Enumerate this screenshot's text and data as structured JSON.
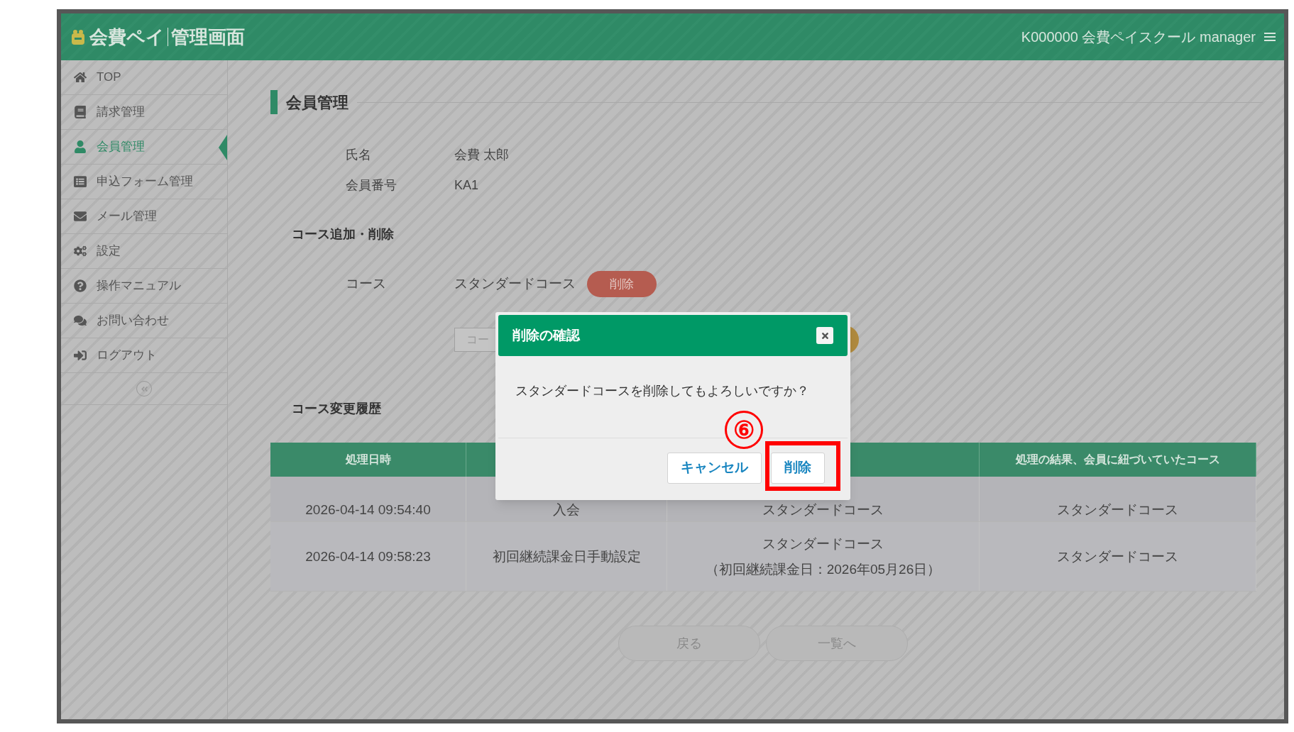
{
  "header": {
    "logo": "会費ペイ",
    "subtitle": "管理画面",
    "account": "K000000 会費ペイスクール manager"
  },
  "sidebar": {
    "items": [
      {
        "label": "TOP",
        "selected": false
      },
      {
        "label": "請求管理",
        "selected": false
      },
      {
        "label": "会員管理",
        "selected": true
      },
      {
        "label": "申込フォーム管理",
        "selected": false
      },
      {
        "label": "メール管理",
        "selected": false
      },
      {
        "label": "設定",
        "selected": false
      },
      {
        "label": "操作マニュアル",
        "selected": false
      },
      {
        "label": "お問い合わせ",
        "selected": false
      },
      {
        "label": "ログアウト",
        "selected": false
      }
    ]
  },
  "page_title": "会員管理",
  "member": [
    {
      "label": "氏名",
      "value": "会費 太郎"
    },
    {
      "label": "会員番号",
      "value": "KA1"
    }
  ],
  "course_section": {
    "title": "コース追加・削除",
    "label": "コース",
    "course": "スタンダードコース",
    "delete_button": "削除",
    "field_placeholder": "コー"
  },
  "history": {
    "title": "コース変更履歴",
    "columns": [
      "処理日時",
      null,
      null,
      "処理の結果、会員に紐づいていたコース"
    ],
    "rows": [
      [
        "2026-04-14 09:54:40",
        "入会",
        "スタンダードコース",
        "スタンダードコース"
      ],
      [
        "2026-04-14 09:58:23",
        "初回継続課金日手動設定",
        [
          "スタンダードコース",
          "（初回継続課金日：2026年05月26日）"
        ],
        "スタンダードコース"
      ]
    ]
  },
  "footer_buttons": [
    "戻る",
    "一覧へ"
  ],
  "dialog": {
    "title": "削除の確認",
    "message": "スタンダードコースを削除してもよろしいですか？",
    "buttons": [
      "キャンセル",
      "削除"
    ],
    "step_marker": "⑥"
  }
}
